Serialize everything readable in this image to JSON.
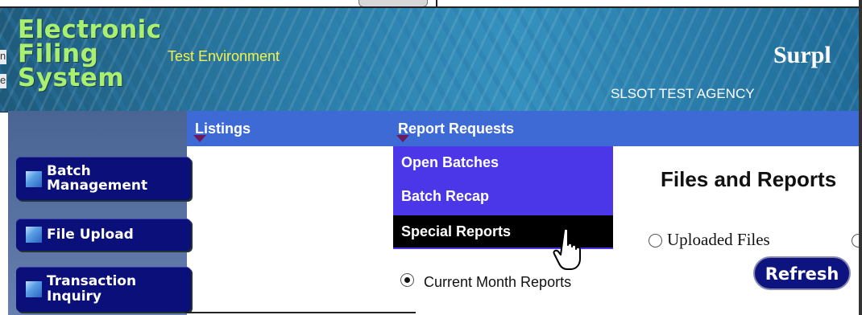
{
  "header": {
    "logo_lines": [
      "Electronic",
      "Filing",
      "System"
    ],
    "environment": "Test Environment",
    "agency_title": "Surpl",
    "agency_name": "SLSOT TEST AGENCY"
  },
  "left_edge": {
    "frag1": "n",
    "frag2": "e"
  },
  "sidebar": {
    "items": [
      {
        "label_lines": [
          "Batch",
          "Management"
        ]
      },
      {
        "label_lines": [
          "File Upload"
        ]
      },
      {
        "label_lines": [
          "Transaction",
          "Inquiry"
        ]
      }
    ]
  },
  "nav": {
    "items": [
      {
        "label": "Listings"
      },
      {
        "label": "Report Requests"
      }
    ]
  },
  "dropdown": {
    "items": [
      {
        "label": "Open Batches"
      },
      {
        "label": "Batch Recap"
      },
      {
        "label": "Special Reports",
        "hovered": true
      }
    ]
  },
  "content": {
    "title": "Files and Reports",
    "options": {
      "uploaded_files": "Uploaded Files",
      "current_month": "Current Month Reports"
    },
    "selected_option": "current_month",
    "refresh_label": "Refresh"
  },
  "colors": {
    "nav_bg": "#3d6ad4",
    "dropdown_bg": "#4b37e8",
    "dropdown_active_bg": "#000000",
    "sidebar_button_bg": "#0b0f7a",
    "logo_text": "#aaf070",
    "environment_text": "#f2f24a"
  }
}
